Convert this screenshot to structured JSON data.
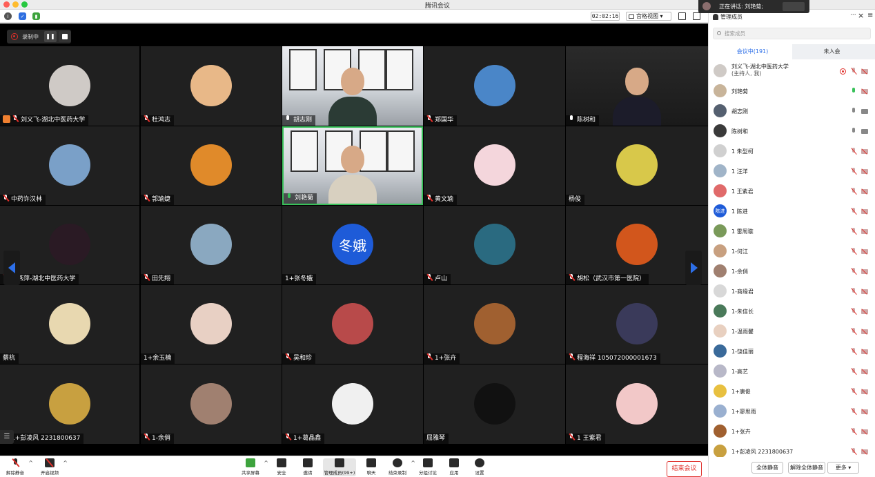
{
  "window": {
    "title": "腾讯会议"
  },
  "speaking": {
    "label": "正在讲话: 刘艳菊;"
  },
  "infobar": {
    "timer": "02:02:16",
    "view_label": "宫格视图"
  },
  "recording": {
    "label": "录制中",
    "pause": "❚❚"
  },
  "tiles": [
    {
      "name": "刘义飞-湖北中医药大学",
      "mic": "muted",
      "host": true,
      "color": "#cfcac6"
    },
    {
      "name": "杜鸿志",
      "mic": "muted",
      "color": "#e8b888"
    },
    {
      "name": "胡志刚",
      "mic": "on",
      "video": true
    },
    {
      "name": "郑国华",
      "mic": "muted",
      "color": "#4a86c8"
    },
    {
      "name": "陈树和",
      "mic": "on",
      "video": true,
      "dark": true
    },
    {
      "name": "中药许汉林",
      "mic": "muted",
      "color": "#7aa0c8"
    },
    {
      "name": "郭瑜婕",
      "mic": "muted",
      "color": "#e08a2a"
    },
    {
      "name": "刘艳菊",
      "mic": "on",
      "green": true,
      "video": true,
      "active": true
    },
    {
      "name": "黄文瑜",
      "mic": "muted",
      "color": "#f4d6dc"
    },
    {
      "name": "杨俊",
      "mic": "none",
      "color": "#d8c84a"
    },
    {
      "name": "周燕萍-湖北中医药大学",
      "mic": "muted",
      "color": "#2a1a24"
    },
    {
      "name": "田先翔",
      "mic": "muted",
      "color": "#8aa8c0"
    },
    {
      "name": "1+张冬娥",
      "mic": "none",
      "text_avatar": "冬娥",
      "color": "#1e5bd8"
    },
    {
      "name": "卢山",
      "mic": "muted",
      "color": "#2a6a80"
    },
    {
      "name": "胡松（武汉市第一医院）",
      "mic": "muted",
      "color": "#d2561c"
    },
    {
      "name": "蔡杭",
      "mic": "none",
      "color": "#e8d8b0"
    },
    {
      "name": "1+余玉楠",
      "mic": "none",
      "color": "#e8d0c4"
    },
    {
      "name": "吴和珍",
      "mic": "muted",
      "color": "#b84a4a"
    },
    {
      "name": "1+张卉",
      "mic": "muted",
      "color": "#a06030"
    },
    {
      "name": "程海祥 105072000001673",
      "mic": "muted",
      "color": "#3a3a5a"
    },
    {
      "name": "1+彭凌风 2231800637",
      "mic": "muted",
      "color": "#c8a040"
    },
    {
      "name": "1-余俏",
      "mic": "muted",
      "color": "#a08070"
    },
    {
      "name": "1+葛晶鑫",
      "mic": "muted",
      "color": "#f0f0f0"
    },
    {
      "name": "屈雅琴",
      "mic": "none",
      "color": "#111111"
    },
    {
      "name": "1 王紫君",
      "mic": "muted",
      "color": "#f2c8c8"
    }
  ],
  "toolbar": {
    "mute": "解除静音",
    "video": "开启视频",
    "share": "共享屏幕",
    "security": "安全",
    "invite": "邀请",
    "members": "管理成员(99+)",
    "chat": "聊天",
    "end_record": "结束录制",
    "breakout": "分组讨论",
    "apps": "应用",
    "settings": "设置",
    "end_meeting": "结束会议"
  },
  "sidebar": {
    "title": "管理成员",
    "search_placeholder": "搜索成员",
    "tab_in": "会议中(191)",
    "tab_out": "未入会",
    "members": [
      {
        "name": "刘义飞-湖北中医药大学",
        "sub": "(主持人, 我)",
        "mic": "muted",
        "rec": true,
        "color": "#cfcac6"
      },
      {
        "name": "刘艳菊",
        "mic": "green",
        "cam": "muted",
        "color": "#c8b49a"
      },
      {
        "name": "胡志刚",
        "mic": "gray",
        "cam": "gray",
        "color": "#556070"
      },
      {
        "name": "陈树和",
        "mic": "gray",
        "cam": "gray",
        "color": "#3a3a3a"
      },
      {
        "name": "1 朱型柯",
        "mic": "muted",
        "cam": "muted",
        "color": "#d0d0d0"
      },
      {
        "name": "1 汪洋",
        "mic": "muted",
        "cam": "muted",
        "color": "#a0b4c8"
      },
      {
        "name": "1 王紫君",
        "mic": "muted",
        "cam": "muted",
        "color": "#e06a6a"
      },
      {
        "name": "1 陈进",
        "mic": "muted",
        "cam": "muted",
        "color": "#1e5bd8",
        "text": "陈进"
      },
      {
        "name": "1 雷周璇",
        "mic": "muted",
        "cam": "muted",
        "color": "#7a9a5a"
      },
      {
        "name": "1-何江",
        "mic": "muted",
        "cam": "muted",
        "color": "#c8a080"
      },
      {
        "name": "1-余俏",
        "mic": "muted",
        "cam": "muted",
        "color": "#a08070"
      },
      {
        "name": "1-商缘君",
        "mic": "muted",
        "cam": "muted",
        "color": "#d8d8d8"
      },
      {
        "name": "1-朱信长",
        "mic": "muted",
        "cam": "muted",
        "color": "#4a7a5a"
      },
      {
        "name": "1-温雨馨",
        "mic": "muted",
        "cam": "muted",
        "color": "#e8d0c0"
      },
      {
        "name": "1-饶佳丽",
        "mic": "muted",
        "cam": "muted",
        "color": "#3a6a9a"
      },
      {
        "name": "1-高艺",
        "mic": "muted",
        "cam": "muted",
        "color": "#b8b8c8"
      },
      {
        "name": "1+唐俊",
        "mic": "muted",
        "cam": "muted",
        "color": "#e8c040"
      },
      {
        "name": "1+廖思雨",
        "mic": "muted",
        "cam": "muted",
        "color": "#9ab0d0"
      },
      {
        "name": "1+张卉",
        "mic": "muted",
        "cam": "muted",
        "color": "#a06030"
      },
      {
        "name": "1+彭凌风 2231800637",
        "mic": "muted",
        "cam": "muted",
        "color": "#c8a040"
      }
    ],
    "mute_all": "全体静音",
    "unmute_all": "解除全体静音",
    "more": "更多 ▾"
  }
}
